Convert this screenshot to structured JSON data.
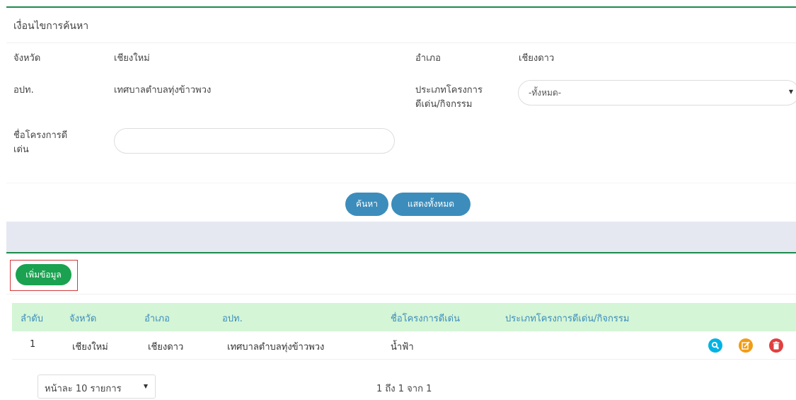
{
  "search_panel": {
    "title": "เงื่อนไขการค้นหา",
    "province_label": "จังหวัด",
    "province_value": "เชียงใหม่",
    "district_label": "อำเภอ",
    "district_value": "เชียงดาว",
    "org_label": "อปท.",
    "org_value": "เทศบาลตำบลทุ่งข้าวพวง",
    "project_type_label_line1": "ประเภทโครงการ",
    "project_type_label_line2": "ดีเด่น/กิจกรรม",
    "project_type_selected": "-ทั้งหมด-",
    "project_name_label_line1": "ชื่อโครงการดี",
    "project_name_label_line2": "เด่น",
    "project_name_value": "",
    "search_button": "ค้นหา",
    "show_all_button": "แสดงทั้งหมด"
  },
  "list_panel": {
    "add_button": "เพิ่มข้อมูล",
    "columns": [
      "ลำดับ",
      "จังหวัด",
      "อำเภอ",
      "อปท.",
      "ชื่อโครงการดีเด่น",
      "ประเภทโครงการดีเด่น/กิจกรรม"
    ],
    "rows": [
      {
        "index": "1",
        "province": "เชียงใหม่",
        "district": "เชียงดาว",
        "org": "เทศบาลตำบลทุ่งข้าวพวง",
        "project": "น้ำฟ้า",
        "type": ""
      }
    ],
    "page_size_selected": "หน้าละ 10 รายการ",
    "page_info": "1 ถึง 1 จาก 1"
  },
  "icons": {
    "view": "search-icon",
    "edit": "edit-icon",
    "delete": "trash-icon"
  },
  "colors": {
    "primary": "#3c8dbc",
    "success": "#1aa251",
    "warning": "#f39c12",
    "danger": "#e04040",
    "info": "#00b3e6",
    "table_header_bg": "#d4f5d6",
    "panel_accent": "#1e8a4c"
  }
}
